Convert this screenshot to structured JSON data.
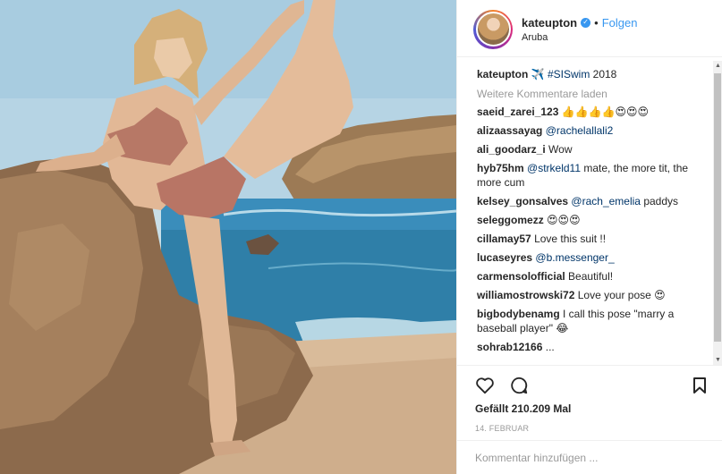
{
  "post": {
    "username": "kateupton",
    "follow_label": "Folgen",
    "location": "Aruba",
    "dot": "•",
    "verified_glyph": "✓",
    "caption": {
      "username": "kateupton",
      "text_before_emoji": " ",
      "emoji": "airplane-emoji",
      "hashtag": "#SISwim",
      "year": " 2018"
    },
    "load_more": "Weitere Kommentare laden",
    "comments": [
      {
        "user": "saeid_zarei_123",
        "text": "",
        "emoji": "👍👍👍👍😍😍😍"
      },
      {
        "user": "alizaassayag",
        "mention": "@rachelallali2",
        "text": ""
      },
      {
        "user": "ali_goodarz_i",
        "text": "Wow"
      },
      {
        "user": "hyb75hm",
        "mention": "@strkeld11",
        "text": " mate, the more tit, the more cum"
      },
      {
        "user": "kelsey_gonsalves",
        "mention": "@rach_emelia",
        "text": " paddys"
      },
      {
        "user": "seleggomezz",
        "text": "",
        "emoji": "😍😍😍"
      },
      {
        "user": "cillamay57",
        "text": "Love this suit !!"
      },
      {
        "user": "lucaseyres",
        "mention": "@b.messenger_",
        "text": ""
      },
      {
        "user": "carmensolofficial",
        "text": "Beautiful!"
      },
      {
        "user": "williamostrowski72",
        "text": "Love your pose ",
        "emoji": "😍"
      },
      {
        "user": "bigbodybenamg",
        "text": "I call this pose \"marry a baseball player\" ",
        "emoji": "😂"
      },
      {
        "user": "sohrab12166",
        "text": "..."
      }
    ],
    "likes_text": "Gefällt 210.209 Mal",
    "date": "14. FEBRUAR",
    "comment_placeholder": "Kommentar hinzufügen ...",
    "scroll_up": "▲",
    "scroll_down": "▼"
  },
  "icons": {
    "like": "heart-icon",
    "comment": "comment-icon",
    "save": "bookmark-icon"
  },
  "colors": {
    "accent": "#3897f0",
    "link": "#003569",
    "muted": "#999999"
  }
}
